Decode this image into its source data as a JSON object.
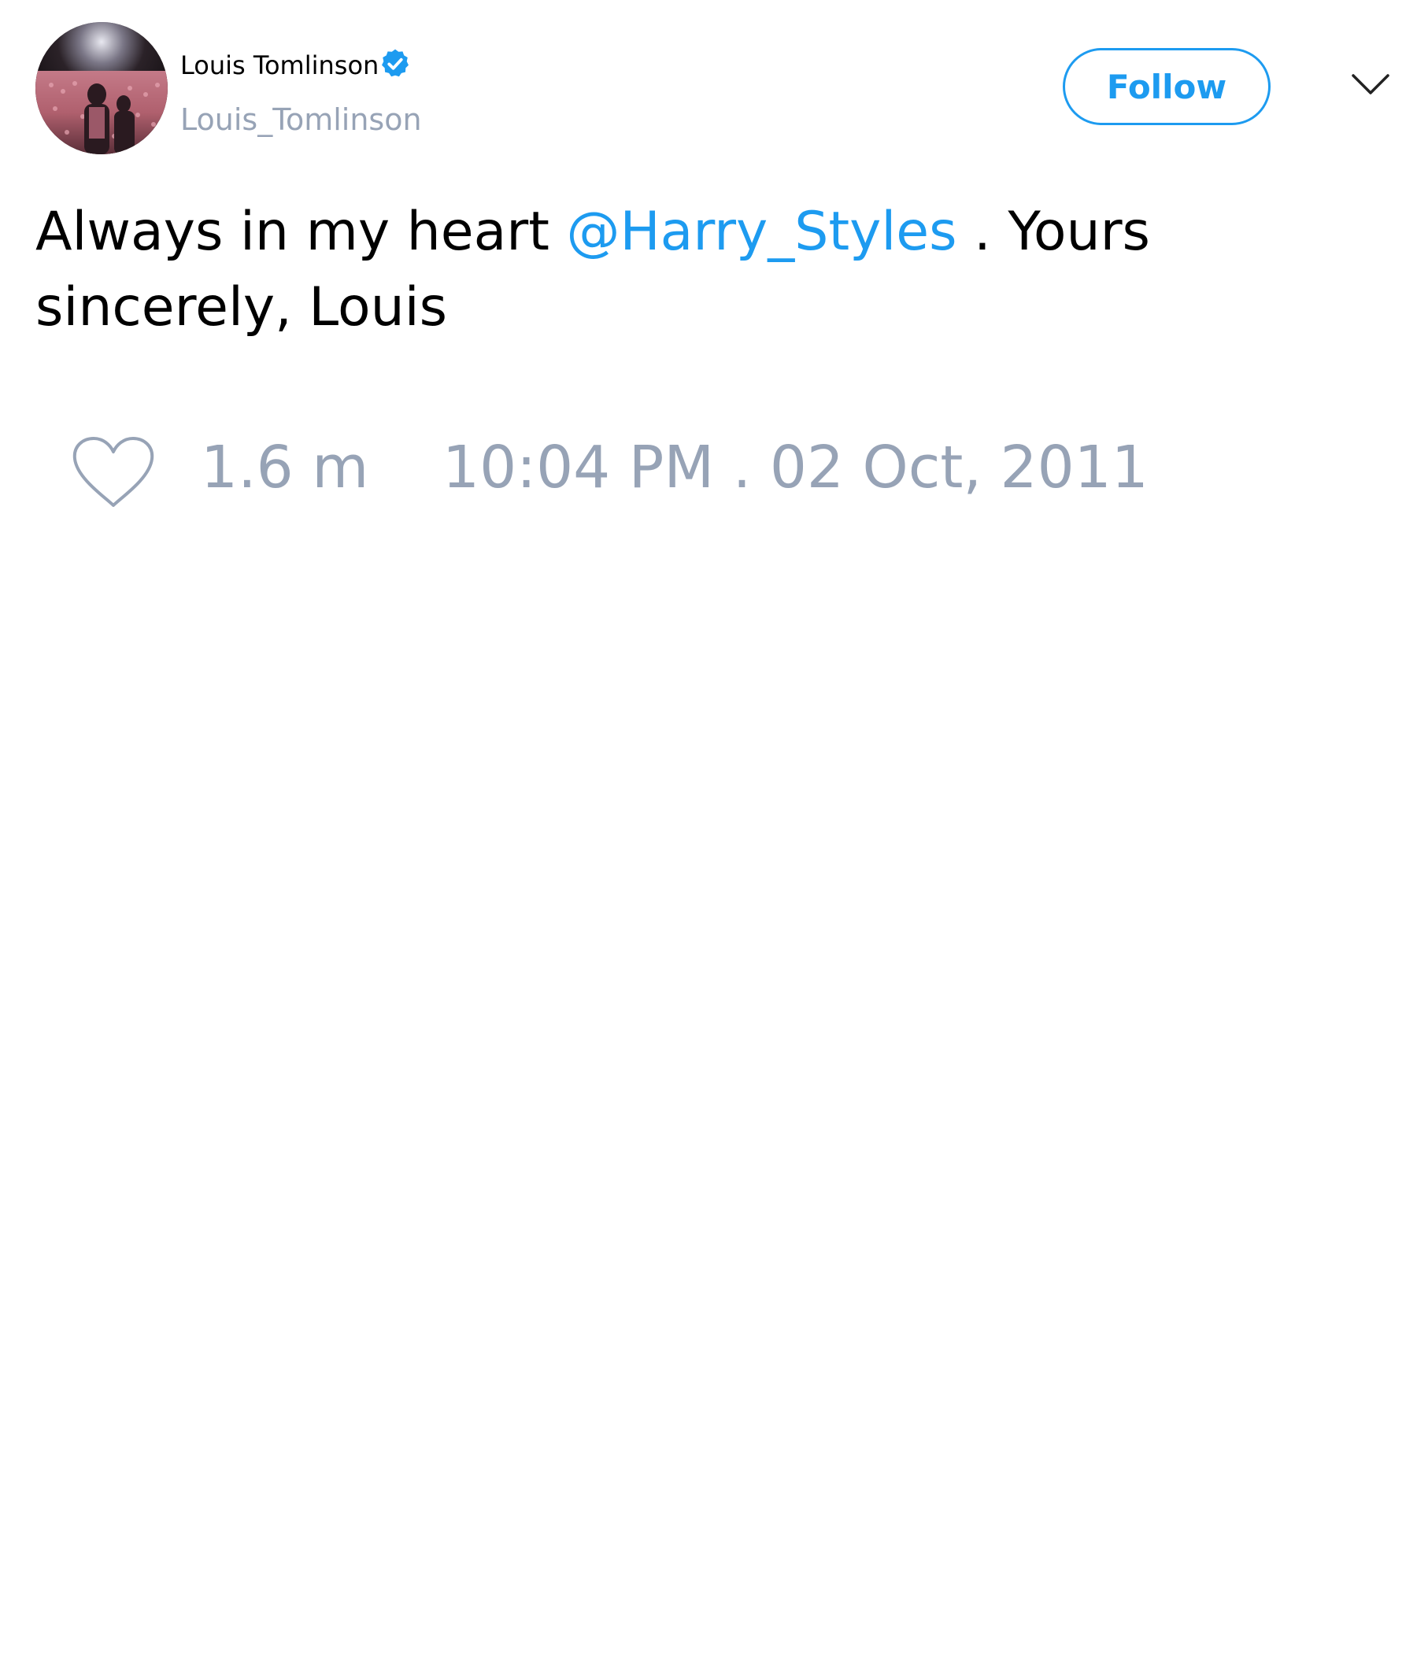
{
  "author": {
    "display_name": "Louis Tomlinson",
    "handle": "Louis_Tomlinson",
    "verified": true,
    "avatar_icon": "profile-photo"
  },
  "actions": {
    "follow_label": "Follow",
    "menu_icon": "chevron-down-icon"
  },
  "tweet": {
    "text_before": "Always in my heart ",
    "mention": "@Harry_Styles",
    "text_after": " . Yours sincerely, Louis"
  },
  "footer": {
    "like_icon": "heart-icon",
    "likes": "1.6 m",
    "timestamp": "10:04 PM . 02 Oct, 2011"
  },
  "colors": {
    "accent": "#1d9bf0",
    "muted": "#97a3b6",
    "text": "#000000"
  }
}
